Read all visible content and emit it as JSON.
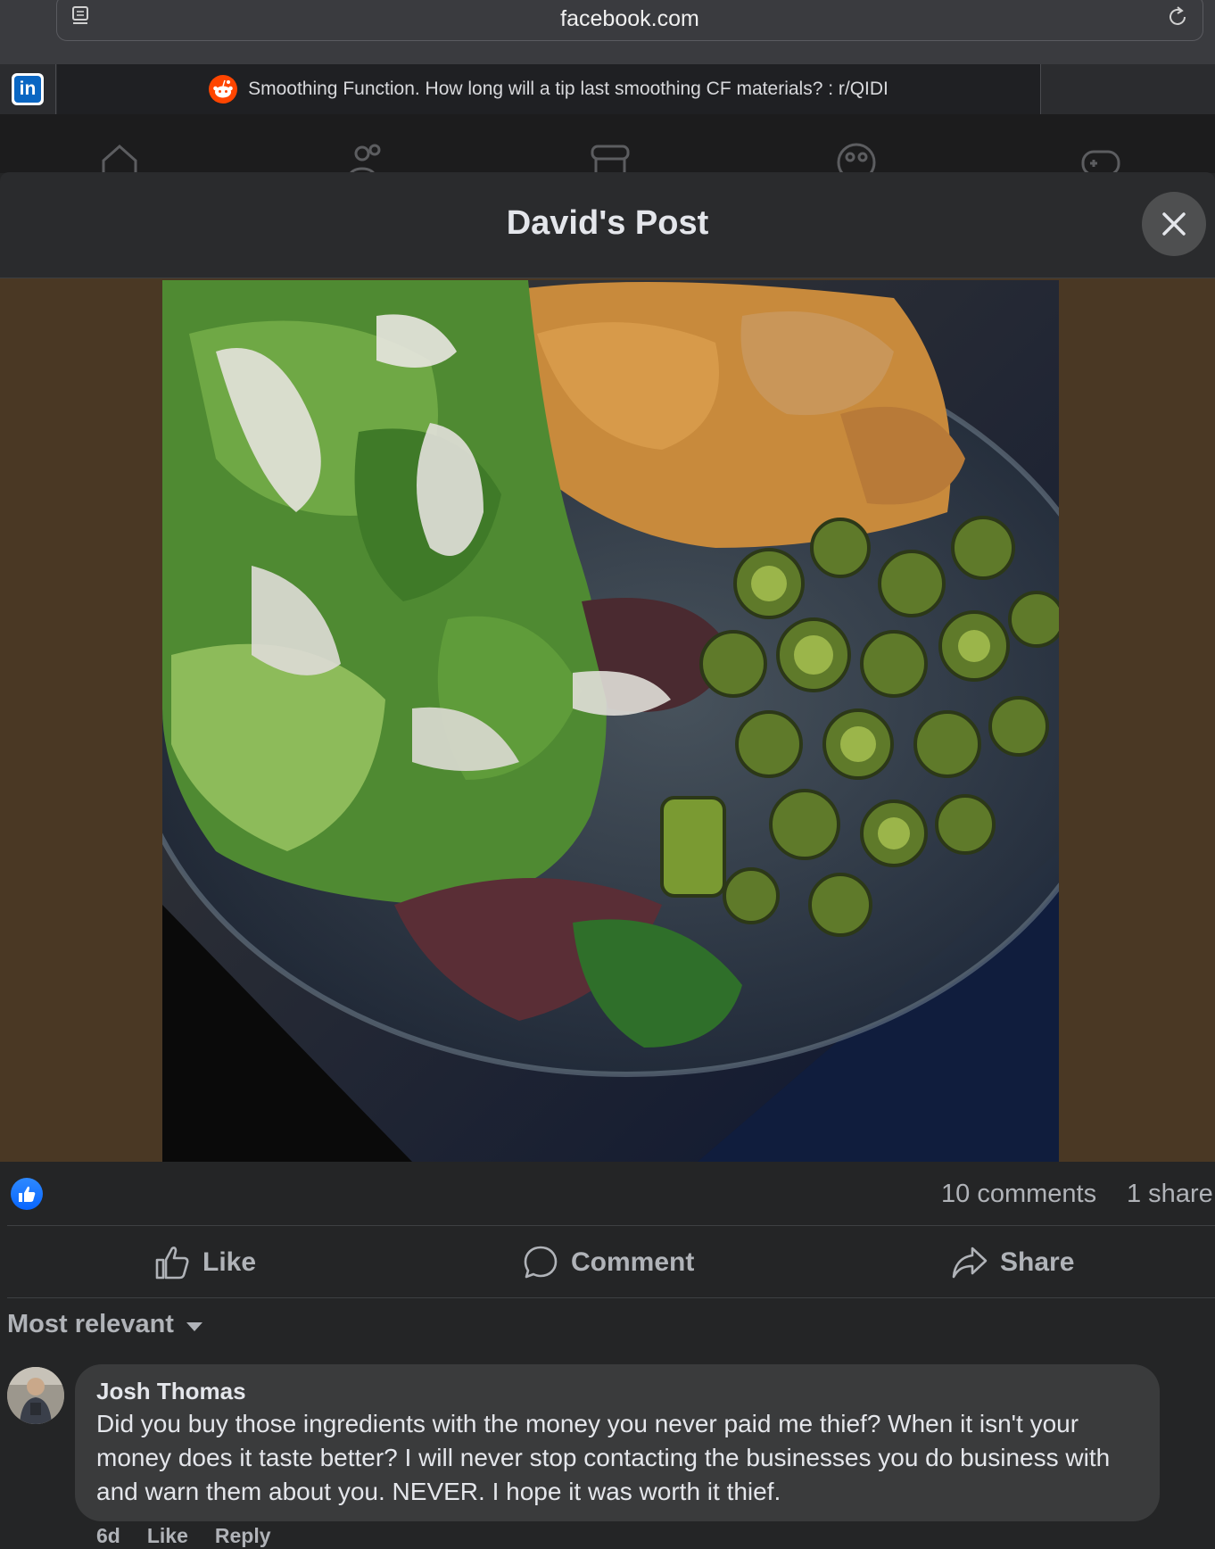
{
  "browser": {
    "url": "facebook.com",
    "active_tab_title": "Smoothing Function. How long will a tip last smoothing CF materials? : r/QIDI",
    "pinned_tab_logo": "in"
  },
  "modal": {
    "title": "David's Post"
  },
  "post": {
    "photo_description_icon": "food-photo",
    "stats": {
      "comments": "10 comments",
      "shares": "1 share"
    },
    "actions": {
      "like": "Like",
      "comment": "Comment",
      "share": "Share"
    }
  },
  "comments_section": {
    "sort_label": "Most relevant",
    "comments": [
      {
        "author": "Josh Thomas",
        "text": "Did you buy those ingredients with the money you never paid me thief? When it isn't your money does it taste better? I will never stop contacting the businesses you do business with and warn them about you. NEVER. I hope it was worth it thief.",
        "time": "6d",
        "like": "Like",
        "reply": "Reply"
      }
    ]
  },
  "colors": {
    "page_bg": "#242526",
    "like_blue": "#0866ff",
    "photo_letterbox": "#4a3824"
  }
}
